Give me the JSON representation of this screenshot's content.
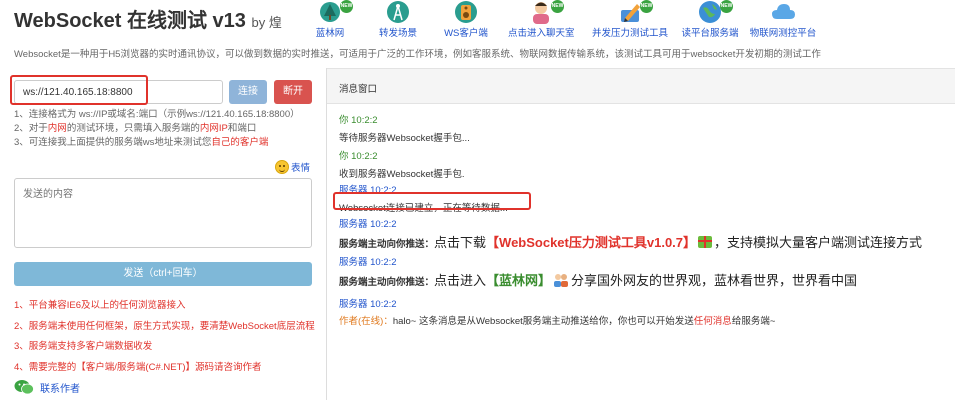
{
  "header": {
    "title": "WebSocket 在线测试 v13",
    "by": "by 煌",
    "intro": "Websocket是一种用于H5浏览器的实时通讯协议，可以做到数据的实时推送，可适用于广泛的工作环境，例如客服系统、物联网数据传输系统，该测试工具可用于websocket开发初期的测试工作"
  },
  "nav": [
    {
      "label": "蓝林网",
      "icon": "blue-forest-icon",
      "is_new": true
    },
    {
      "label": "转发场景",
      "icon": "antenna-icon",
      "is_new": false
    },
    {
      "label": "WS客户端",
      "icon": "speaker-icon",
      "is_new": false
    },
    {
      "label": "点击进入聊天室",
      "icon": "chat-avatar-icon",
      "is_new": true
    },
    {
      "label": "并发压力测试工具",
      "icon": "pencil-tool-icon",
      "is_new": true
    },
    {
      "label": "读平台服务端",
      "icon": "globe-icon",
      "is_new": true
    },
    {
      "label": "物联网测控平台",
      "icon": "cloud-icon",
      "is_new": false
    }
  ],
  "left": {
    "url_value": "ws://121.40.165.18:8800",
    "connect_label": "连接",
    "disconnect_label": "断开",
    "tip1": "1、连接格式为 ws://IP或域名:端口（示例ws://121.40.165.18:8800）",
    "tip2_a": "2、对于",
    "tip2_b": "内网",
    "tip2_c": "的测试环境，只需填入服务端的",
    "tip2_d": "内网IP",
    "tip2_e": "和端口",
    "tip3_a": "3、可连接我上面提供的服务端ws地址来测试您",
    "tip3_b": "自己的客户端",
    "emoji_label": "表情",
    "send_placeholder": "发送的内容",
    "send_label": "发送（ctrl+回车）",
    "notes": [
      "1、平台兼容IE6及以上的任何浏览器接入",
      "2、服务端未使用任何框架，原生方式实现，要清楚WebSocket底层流程",
      "3、服务端支持多客户端数据收发",
      "4、需要完整的【客户端/服务端(C#.NET)】源码请咨询作者"
    ],
    "contact_label": "联系作者"
  },
  "right": {
    "header": "消息窗口",
    "messages": [
      {
        "who": "你 10:2:2",
        "text": "等待服务器Websocket握手包..."
      },
      {
        "who": "你 10:2:2",
        "text": "收到服务器Websocket握手包."
      },
      {
        "who": "服务器 10:2:2",
        "text": "Websocket连接已建立，正在等待数据..."
      },
      {
        "who": "服务器 10:2:2",
        "prefix": "服务端主动向你推送：",
        "text_a": "点击下载",
        "text_b": "【WebSocket压力测试工具v1.0.7】",
        "text_c": "，支持模拟大量客户端测试连接方式"
      },
      {
        "who": "服务器 10:2:2",
        "prefix": "服务端主动向你推送：",
        "text_a": "点击进入",
        "text_b": "【蓝林网】",
        "text_c": "分享国外网友的世界观，蓝林看世界，世界看中国"
      },
      {
        "who": "服务器 10:2:2",
        "author": "作者(在线)：",
        "text_a": "halo~ 这条消息是从Websocket服务端主动推送给你，你也可以开始发送",
        "text_b": "任何消息",
        "text_c": "给服务端~"
      }
    ]
  },
  "colors": {
    "accent_red": "#e0322b",
    "link_blue": "#2255cc",
    "you_green": "#3a8d2f",
    "send_button": "#7fb8d8"
  }
}
